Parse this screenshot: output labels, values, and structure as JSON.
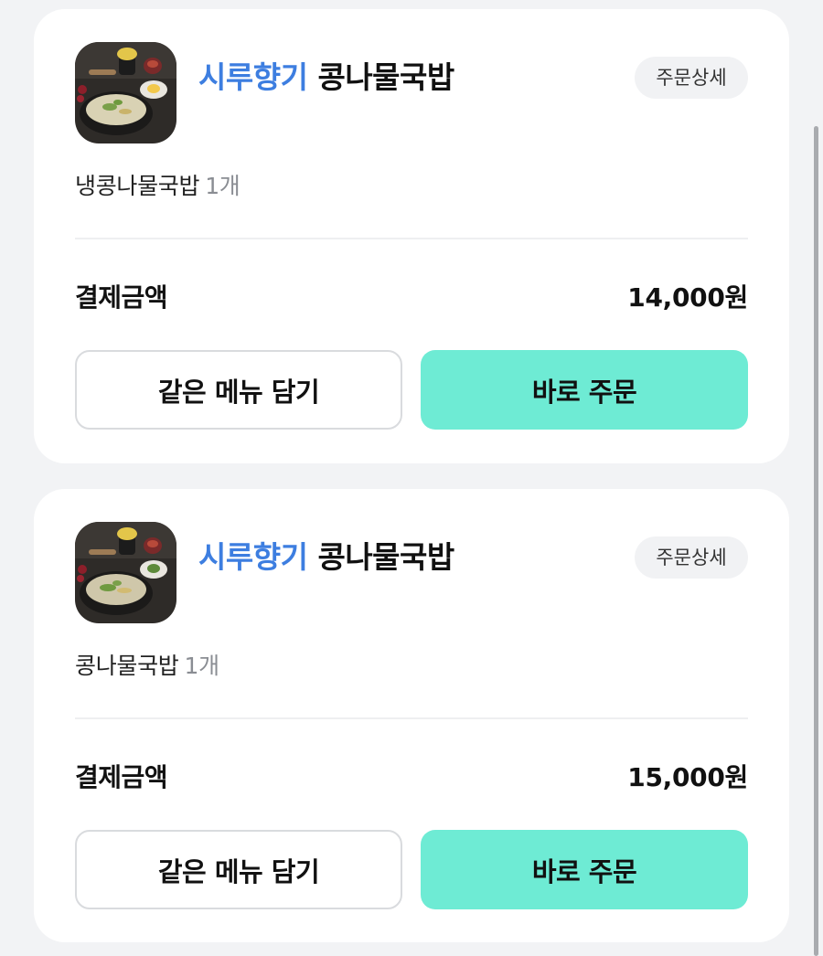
{
  "orders": [
    {
      "store_brand": "시루향기",
      "store_name": "콩나물국밥",
      "detail_label": "주문상세",
      "item_name": "냉콩나물국밥",
      "item_qty": "1개",
      "pay_label": "결제금액",
      "pay_amount": "14,000원",
      "reorder_same_label": "같은 메뉴 담기",
      "order_now_label": "바로 주문"
    },
    {
      "store_brand": "시루향기",
      "store_name": "콩나물국밥",
      "detail_label": "주문상세",
      "item_name": "콩나물국밥",
      "item_qty": "1개",
      "pay_label": "결제금액",
      "pay_amount": "15,000원",
      "reorder_same_label": "같은 메뉴 담기",
      "order_now_label": "바로 주문"
    }
  ],
  "colors": {
    "accent_mint": "#6eebd4",
    "brand_blue": "#3d7ee0",
    "background": "#f2f3f5"
  }
}
